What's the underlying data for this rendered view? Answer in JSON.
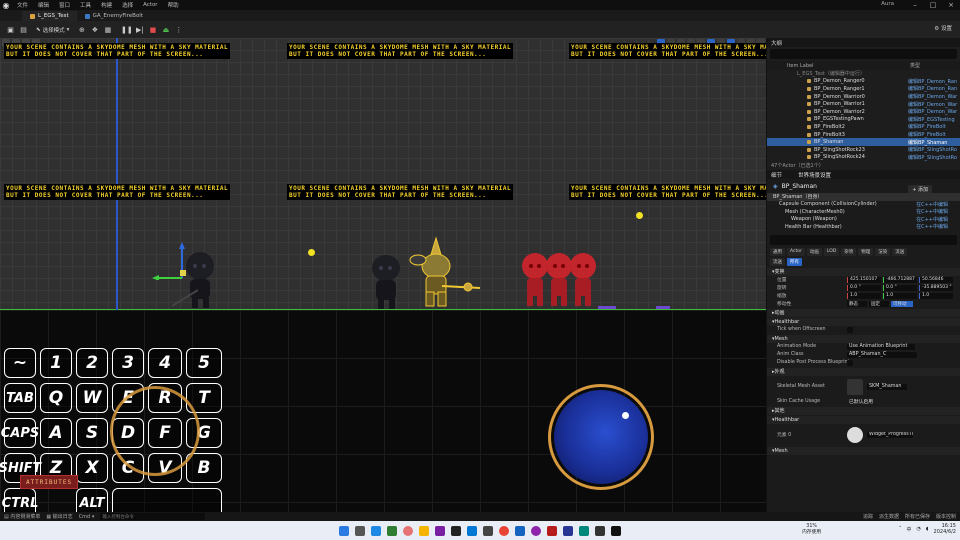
{
  "menubar": {
    "items": [
      "文件",
      "编辑",
      "窗口",
      "工具",
      "构建",
      "选择",
      "Actor",
      "帮助"
    ],
    "user": "Aura"
  },
  "tabs": [
    {
      "label": "L_EGS_Test"
    },
    {
      "label": "GA_EnemyFireBolt"
    }
  ],
  "toolbar": {
    "mode_label": "选择模式",
    "settings_label": "设置"
  },
  "viewport": {
    "sky_warning_line1": "YOUR SCENE CONTAINS A SKYDOME MESH WITH A SKY MATERIAL",
    "sky_warning_line2": "BUT IT DOES NOT COVER THAT PART OF THE SCREEN...",
    "attributes_button": "ATTRIBUTES"
  },
  "keyboard": {
    "row1": [
      "~",
      "1",
      "2",
      "3",
      "4",
      "5"
    ],
    "row2": [
      "TAB",
      "Q",
      "W",
      "E",
      "R",
      "T"
    ],
    "row3": [
      "CAPS",
      "A",
      "S",
      "D",
      "F",
      "G"
    ],
    "row4": [
      "SHIFT",
      "Z",
      "X",
      "C",
      "V",
      "B"
    ],
    "row5": [
      "CTRL",
      "ALT"
    ]
  },
  "outliner": {
    "tab_label": "大纲",
    "col_label": "Item Label",
    "col_type": "类型",
    "level_row": "L_EGS_Test（编辑器中运行）",
    "rows": [
      {
        "name": "BP_Demon_Ranger0",
        "type": "编辑BP_Demon_Ran"
      },
      {
        "name": "BP_Demon_Ranger1",
        "type": "编辑BP_Demon_Ran"
      },
      {
        "name": "BP_Demon_Warrior0",
        "type": "编辑BP_Demon_War"
      },
      {
        "name": "BP_Demon_Warrior1",
        "type": "编辑BP_Demon_War"
      },
      {
        "name": "BP_Demon_Warrior2",
        "type": "编辑BP_Demon_War"
      },
      {
        "name": "BP_EGSTestingPawn",
        "type": "编辑BP_EGSTesting"
      },
      {
        "name": "BP_FireBolt2",
        "type": "编辑BP_FireBolt"
      },
      {
        "name": "BP_FireBolt3",
        "type": "编辑BP_FireBolt"
      },
      {
        "name": "BP_Shaman",
        "type": "编辑BP_Shaman",
        "selected": true
      },
      {
        "name": "BP_SlingShotRock23",
        "type": "编辑BP_SlingShotRo"
      },
      {
        "name": "BP_SlingShotRock24",
        "type": "编辑BP_SlingShotRo"
      }
    ],
    "footer": "47个Actor（已选1个）"
  },
  "details": {
    "tab_details": "细节",
    "tab_world": "世界场景设置",
    "actor_name": "BP_Shaman",
    "add_label": "+ 添加",
    "root_label": "BP_Shaman（自身）",
    "components": [
      {
        "label": "Capsule Component (CollisionCylinder)",
        "edit": "在C++中编辑"
      },
      {
        "label": "Mesh (CharacterMesh0)",
        "edit": "在C++中编辑"
      },
      {
        "label": "Weapon (Weapon)",
        "edit": "在C++中编辑"
      },
      {
        "label": "Health Bar (Healthbar)",
        "edit": "在C++中编辑"
      }
    ],
    "filters_row1": [
      "通用",
      "Actor",
      "动画",
      "LOD",
      "杂项",
      "物理",
      "渲染",
      "流送"
    ],
    "filters_row2": [
      "流送",
      "所有"
    ],
    "transform_section": "变换",
    "location_label": "位置",
    "location": [
      "425.150107",
      "-466.712887",
      "50.56846"
    ],
    "rotation_label": "旋转",
    "rotation": [
      "0.0 °",
      "0.0 °",
      "-35.889503 °"
    ],
    "scale_label": "缩放",
    "scale": [
      "1.0",
      "1.0",
      "1.0"
    ],
    "mobility_label": "移动性",
    "mobility_options": [
      "静态",
      "固定",
      "可移动"
    ],
    "sections": {
      "anim": "动画",
      "healthbar": "Healthbar",
      "mesh": "Mesh",
      "appearance": "外观",
      "skeletal": "Skeletal Mesh Asset",
      "skin": "Skin Cache Usage",
      "healthbar2": "Healthbar",
      "mesh2": "Mesh"
    },
    "tick_label": "Tick when Offscreen",
    "anim_mode_label": "Animation Mode",
    "anim_mode_value": "Use Animation Blueprint",
    "anim_class_label": "Anim Class",
    "anim_class_value": "ABP_Shaman_C",
    "disable_pp_label": "Disable Post Process Blueprint",
    "skm_value": "SKM_Shaman",
    "skin_value": "已默认启用",
    "element_label": "元素 0",
    "widget_value": "Widget_ProgressThrough_Masked_Over"
  },
  "statusbar": {
    "content_drawer": "内容侧滑菜单",
    "output_log": "输出日志",
    "cmd": "Cmd",
    "cmd_placeholder": "输入控制台命令",
    "trace": "追踪",
    "derived": "派生数据",
    "all_saved": "所有已保存",
    "version_control": "版本控制"
  },
  "taskbar": {
    "weather_temp": "31%",
    "weather_text": "内存使用",
    "time": "16:15",
    "date": "2024/6/2",
    "lang": "中"
  }
}
